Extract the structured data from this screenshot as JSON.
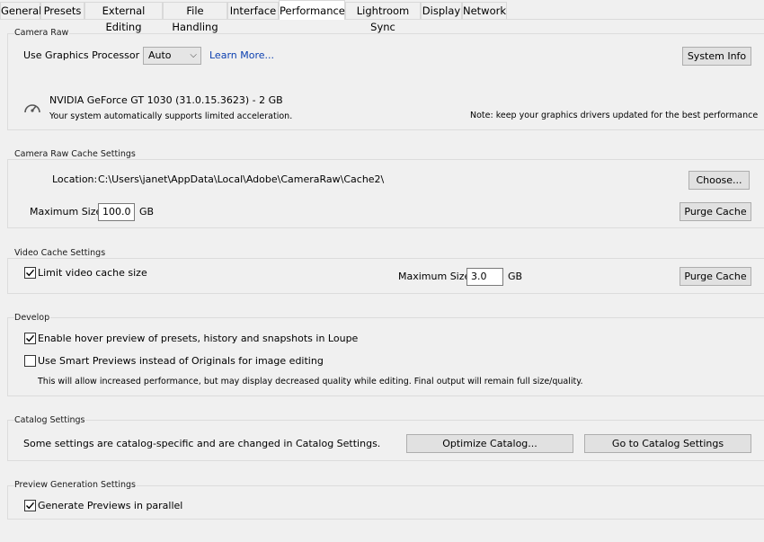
{
  "tabs": [
    {
      "label": "General",
      "active": false
    },
    {
      "label": "Presets",
      "active": false
    },
    {
      "label": "External Editing",
      "active": false
    },
    {
      "label": "File Handling",
      "active": false
    },
    {
      "label": "Interface",
      "active": false
    },
    {
      "label": "Performance",
      "active": true
    },
    {
      "label": "Lightroom Sync",
      "active": false
    },
    {
      "label": "Display",
      "active": false
    },
    {
      "label": "Network",
      "active": false
    }
  ],
  "camera_raw": {
    "title": "Camera Raw",
    "gpu_label": "Use Graphics Processor :",
    "gpu_value": "Auto",
    "learn_more": "Learn More...",
    "system_info": "System Info",
    "gpu_name": "NVIDIA GeForce GT 1030 (31.0.15.3623) - 2 GB",
    "gpu_status": "Your system automatically supports limited acceleration.",
    "gpu_note": "Note: keep your graphics drivers updated for the best performance",
    "gauge_icon": "gauge-icon"
  },
  "cache": {
    "title": "Camera Raw Cache Settings",
    "location_label": "Location:",
    "location_value": "C:\\Users\\janet\\AppData\\Local\\Adobe\\CameraRaw\\Cache2\\",
    "choose": "Choose...",
    "max_label": "Maximum Size:",
    "max_value": "100.0",
    "max_unit": "GB",
    "purge": "Purge Cache"
  },
  "video": {
    "title": "Video Cache Settings",
    "limit_label": "Limit video cache size",
    "limit_checked": true,
    "max_label": "Maximum Size:",
    "max_value": "3.0",
    "max_unit": "GB",
    "purge": "Purge Cache"
  },
  "develop": {
    "title": "Develop",
    "hover_label": "Enable hover preview of presets, history and snapshots in Loupe",
    "hover_checked": true,
    "smart_label": "Use Smart Previews instead of Originals for image editing",
    "smart_checked": false,
    "smart_note": "This will allow increased performance, but may display decreased quality while editing. Final output will remain full size/quality."
  },
  "catalog": {
    "title": "Catalog Settings",
    "text": "Some settings are catalog-specific and are changed in Catalog Settings.",
    "optimize": "Optimize Catalog...",
    "goto": "Go to Catalog Settings"
  },
  "preview": {
    "title": "Preview Generation Settings",
    "parallel_label": "Generate Previews in parallel",
    "parallel_checked": true
  }
}
